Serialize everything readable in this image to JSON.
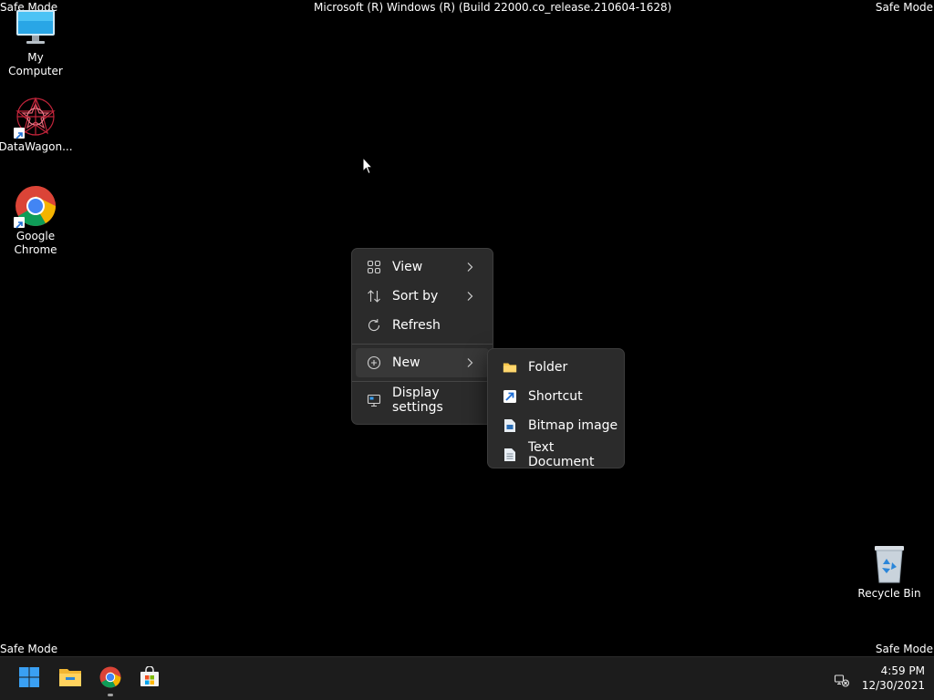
{
  "overlay": {
    "safe_mode_tl": "Safe Mode",
    "safe_mode_tr": "Safe Mode",
    "safe_mode_bl": "Safe Mode",
    "safe_mode_br": "Safe Mode",
    "build": "Microsoft (R) Windows (R) (Build 22000.co_release.210604-1628)"
  },
  "desktop": {
    "icons": [
      {
        "label": "My Computer",
        "icon": "monitor-icon"
      },
      {
        "label": "DataWagon...",
        "icon": "datawagon-icon"
      },
      {
        "label": "Google Chrome",
        "icon": "chrome-icon"
      },
      {
        "label": "Recycle Bin",
        "icon": "recycle-bin-icon"
      }
    ]
  },
  "context_menu": {
    "items": [
      {
        "label": "View",
        "icon": "grid-icon",
        "has_submenu": true
      },
      {
        "label": "Sort by",
        "icon": "sort-icon",
        "has_submenu": true
      },
      {
        "label": "Refresh",
        "icon": "refresh-icon",
        "has_submenu": false
      },
      {
        "label": "New",
        "icon": "plus-circle-icon",
        "has_submenu": true
      },
      {
        "label": "Display settings",
        "icon": "display-settings-icon",
        "has_submenu": false
      }
    ]
  },
  "submenu_new": {
    "items": [
      {
        "label": "Folder",
        "icon": "folder-icon"
      },
      {
        "label": "Shortcut",
        "icon": "shortcut-icon"
      },
      {
        "label": "Bitmap image",
        "icon": "bitmap-icon"
      },
      {
        "label": "Text Document",
        "icon": "text-document-icon"
      }
    ]
  },
  "taskbar": {
    "apps": [
      {
        "name": "Start",
        "icon": "windows-start-icon"
      },
      {
        "name": "File Explorer",
        "icon": "file-explorer-icon"
      },
      {
        "name": "Google Chrome",
        "icon": "chrome-icon",
        "running": true
      },
      {
        "name": "Microsoft Store",
        "icon": "store-icon"
      }
    ],
    "tray": {
      "network_icon": "network-disconnected-icon"
    },
    "clock": {
      "time": "4:59 PM",
      "date": "12/30/2021"
    }
  },
  "colors": {
    "desktop_bg": "#000000",
    "menu_bg": "#2b2b2b",
    "menu_hover": "#383838",
    "taskbar_bg": "#1c1c1c",
    "accent": "#3aa0f3"
  }
}
